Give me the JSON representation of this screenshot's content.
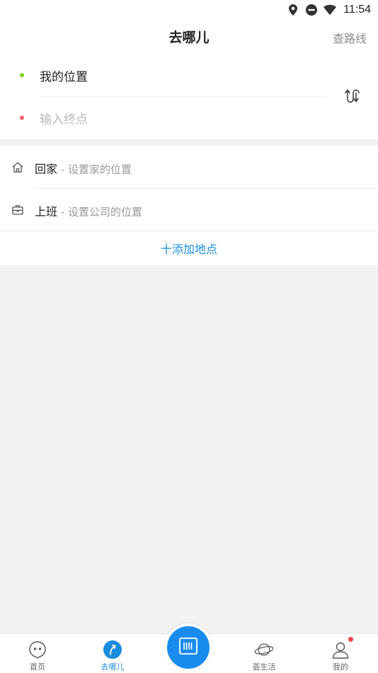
{
  "status_bar": {
    "time": "11:54",
    "icons": [
      "location-icon",
      "do-not-disturb-icon",
      "wifi-icon"
    ]
  },
  "header": {
    "title": "去哪儿",
    "route_link": "查路线"
  },
  "route": {
    "start_label": "我的位置",
    "end_placeholder": "输入终点",
    "start_dot_color": "#7ed321",
    "end_dot_color": "#f0646c",
    "swap_icon": "swap-route-icon"
  },
  "places": [
    {
      "name": "回家",
      "separator": " - ",
      "hint": "设置家的位置",
      "icon": "home-icon"
    },
    {
      "name": "上班",
      "separator": " - ",
      "hint": "设置公司的位置",
      "icon": "briefcase-icon"
    }
  ],
  "add_place": "十添加地点",
  "bottom_nav": {
    "items": [
      {
        "label": "首页",
        "icon": "home-face-icon",
        "active": false
      },
      {
        "label": "去哪儿",
        "icon": "navigate-icon",
        "active": true
      },
      {
        "label": "荟生活",
        "icon": "planet-icon",
        "active": false
      },
      {
        "label": "我的",
        "icon": "user-icon",
        "active": false,
        "badge": true
      }
    ],
    "center_button_icon": "scan-icon"
  },
  "colors": {
    "accent": "#1a8cdc",
    "background": "#f2f2f2",
    "badge": "#f0464c"
  }
}
